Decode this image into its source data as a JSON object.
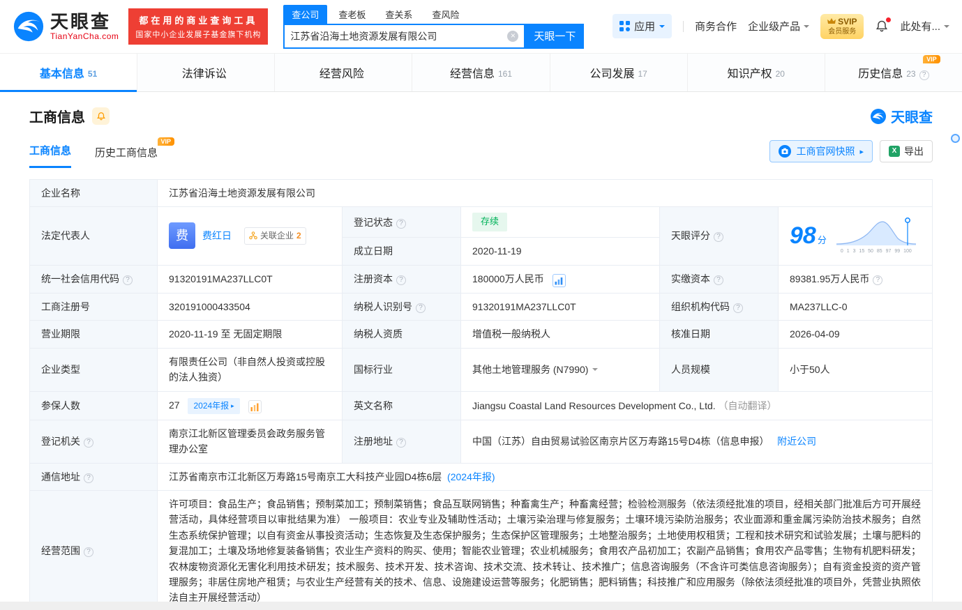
{
  "header": {
    "logo_cn": "天眼查",
    "logo_en": "TianYanCha.com",
    "slogan_line1": "都在用的商业查询工具",
    "slogan_line2": "国家中小企业发展子基金旗下机构",
    "search_tabs": [
      {
        "label": "查公司",
        "active": true
      },
      {
        "label": "查老板",
        "active": false
      },
      {
        "label": "查关系",
        "active": false
      },
      {
        "label": "查风险",
        "active": false
      }
    ],
    "search_value": "江苏省沿海土地资源发展有限公司",
    "search_button": "天眼一下",
    "apps_label": "应用",
    "biz_coop": "商务合作",
    "enterprise_product": "企业级产品",
    "svip_line1": "SVIP",
    "svip_line2": "会员服务",
    "user_label": "此处有..."
  },
  "nav": {
    "tabs": [
      {
        "label": "基本信息",
        "count": "51",
        "active": true
      },
      {
        "label": "法律诉讼",
        "count": ""
      },
      {
        "label": "经营风险",
        "count": ""
      },
      {
        "label": "经营信息",
        "count": "161"
      },
      {
        "label": "公司发展",
        "count": "17"
      },
      {
        "label": "知识产权",
        "count": "20"
      },
      {
        "label": "历史信息",
        "count": "23",
        "vip": "VIP"
      }
    ]
  },
  "section": {
    "title": "工商信息",
    "watermark": "天眼查",
    "subtab_active": "工商信息",
    "subtab_history": "历史工商信息",
    "vip_label": "VIP",
    "snapshot_button": "工商官网快照",
    "export_button": "导出"
  },
  "info": {
    "company_name": {
      "label": "企业名称",
      "value": "江苏省沿海土地资源发展有限公司"
    },
    "legal_rep": {
      "label": "法定代表人",
      "avatar": "费",
      "name": "费红日",
      "tag": "关联企业",
      "tag_count": "2"
    },
    "reg_status": {
      "label": "登记状态",
      "value": "存续"
    },
    "establish_date": {
      "label": "成立日期",
      "value": "2020-11-19"
    },
    "score": {
      "label": "天眼评分",
      "value": "98",
      "unit": "分",
      "axis": "0 1 3 15 50 85 97 99 100"
    },
    "credit_code": {
      "label": "统一社会信用代码",
      "value": "91320191MA237LLC0T"
    },
    "reg_capital": {
      "label": "注册资本",
      "value": "180000万人民币"
    },
    "paid_capital": {
      "label": "实缴资本",
      "value": "89381.95万人民币"
    },
    "reg_number": {
      "label": "工商注册号",
      "value": "320191000433504"
    },
    "taxpayer_id": {
      "label": "纳税人识别号",
      "value": "91320191MA237LLC0T"
    },
    "org_code": {
      "label": "组织机构代码",
      "value": "MA237LLC-0"
    },
    "business_term": {
      "label": "营业期限",
      "value": "2020-11-19 至 无固定期限"
    },
    "taxpayer_quality": {
      "label": "纳税人资质",
      "value": "增值税一般纳税人"
    },
    "approval_date": {
      "label": "核准日期",
      "value": "2026-04-09"
    },
    "company_type": {
      "label": "企业类型",
      "value": "有限责任公司（非自然人投资或控股的法人独资）"
    },
    "industry": {
      "label": "国标行业",
      "value": "其他土地管理服务 (N7990)"
    },
    "staff_size": {
      "label": "人员规模",
      "value": "小于50人"
    },
    "insured_count": {
      "label": "参保人数",
      "value": "27",
      "tag": "2024年报"
    },
    "english_name": {
      "label": "英文名称",
      "value": "Jiangsu Coastal Land Resources Development Co., Ltd.",
      "note": "（自动翻译）"
    },
    "reg_authority": {
      "label": "登记机关",
      "value": "南京江北新区管理委员会政务服务管理办公室"
    },
    "reg_address": {
      "label": "注册地址",
      "value": "中国（江苏）自由贸易试验区南京片区万寿路15号D4栋（信息申报）",
      "link": "附近公司"
    },
    "mail_address": {
      "label": "通信地址",
      "value": "江苏省南京市江北新区万寿路15号南京工大科技产业园D4栋6层",
      "link": "(2024年报)"
    },
    "business_scope": {
      "label": "经营范围",
      "value": "许可项目：食品生产；食品销售；预制菜加工；预制菜销售；食品互联网销售；种畜禽生产；种畜禽经营；检验检测服务（依法须经批准的项目，经相关部门批准后方可开展经营活动，具体经营项目以审批结果为准） 一般项目：农业专业及辅助性活动；土壤污染治理与修复服务；土壤环境污染防治服务；农业面源和重金属污染防治技术服务；自然生态系统保护管理；以自有资金从事投资活动；生态恢复及生态保护服务；生态保护区管理服务；土地整治服务；土地使用权租赁；工程和技术研究和试验发展；土壤与肥料的复混加工；土壤及场地修复装备销售；农业生产资料的购买、使用；智能农业管理；农业机械服务；食用农产品初加工；农副产品销售；食用农产品零售；生物有机肥料研发；农林废物资源化无害化利用技术研发；技术服务、技术开发、技术咨询、技术交流、技术转让、技术推广；信息咨询服务（不含许可类信息咨询服务）；自有资金投资的资产管理服务；非居住房地产租赁；与农业生产经营有关的技术、信息、设施建设运营等服务；化肥销售；肥料销售；科技推广和应用服务（除依法须经批准的项目外，凭营业执照依法自主开展经营活动）"
    }
  },
  "colors": {
    "brand_blue": "#0a84ff",
    "brand_red": "#ee3f34",
    "vip_orange": "#ff9100",
    "status_green": "#00b259"
  }
}
